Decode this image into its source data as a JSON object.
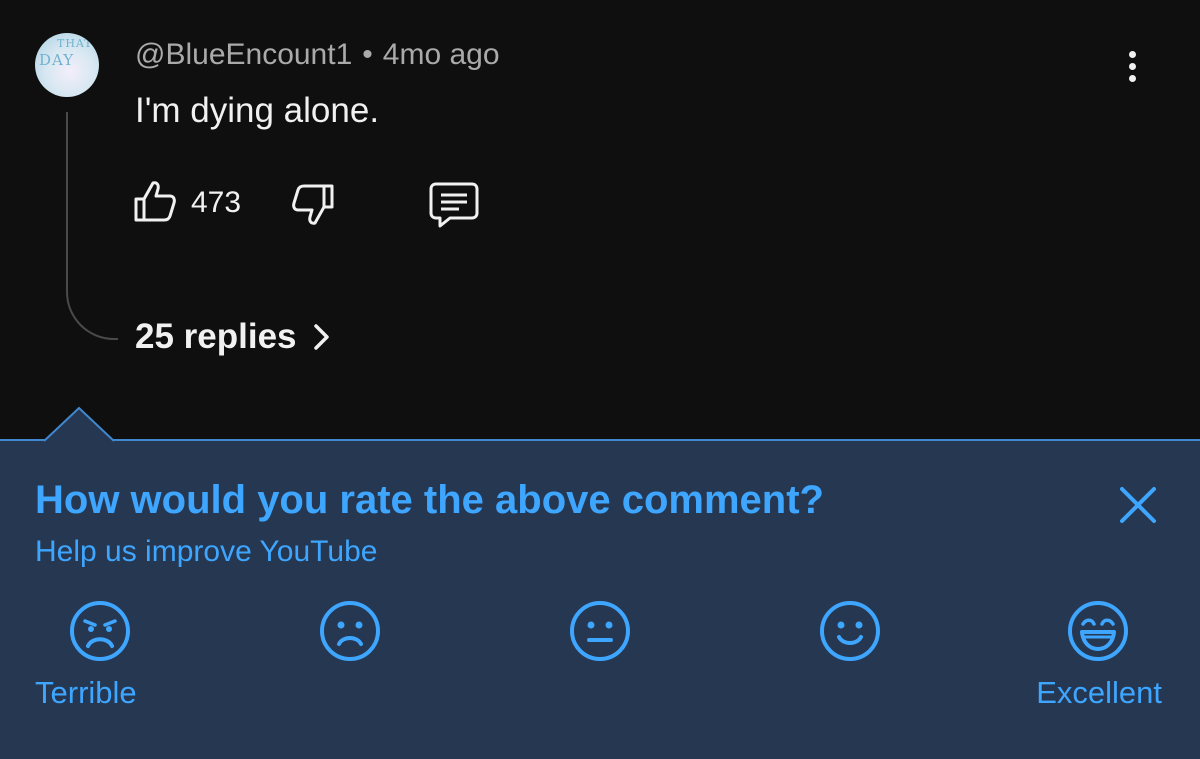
{
  "comment": {
    "author": "@BlueEncount1",
    "separator": "•",
    "time_ago": "4mo ago",
    "text": "I'm dying alone.",
    "like_count": "473",
    "replies_label": "25 replies",
    "more_icon": "vertical-ellipsis-icon",
    "like_icon": "thumbs-up-icon",
    "dislike_icon": "thumbs-down-icon",
    "reply_icon": "comment-bubble-icon",
    "replies_chevron_icon": "chevron-right-icon",
    "avatar_text": "THAT DAY"
  },
  "rating_panel": {
    "title": "How would you rate the above comment?",
    "subtitle": "Help us improve YouTube",
    "close_icon": "close-icon",
    "low_label": "Terrible",
    "high_label": "Excellent",
    "options": [
      {
        "icon": "terrible-face-icon"
      },
      {
        "icon": "sad-face-icon"
      },
      {
        "icon": "neutral-face-icon"
      },
      {
        "icon": "smile-face-icon"
      },
      {
        "icon": "grin-face-icon"
      }
    ]
  },
  "colors": {
    "background": "#0f0f0f",
    "panel_background": "#263752",
    "accent": "#3ea6ff",
    "text_primary": "#f1f1f1",
    "text_secondary": "#aaaaaa"
  }
}
